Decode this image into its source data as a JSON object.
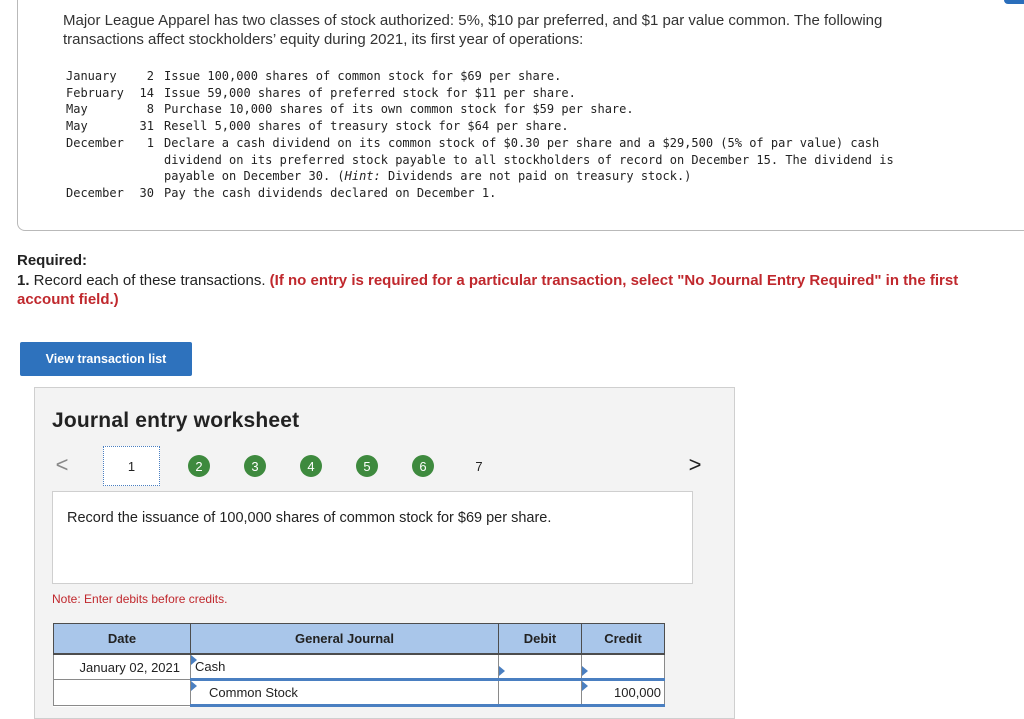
{
  "intro": "Major League Apparel has two classes of stock authorized: 5%, $10 par preferred, and $1 par value common. The following transactions affect stockholders’ equity during 2021, its first year of operations:",
  "transactions": [
    {
      "month": "January",
      "day": "2",
      "text": "Issue 100,000 shares of common stock for $69 per share."
    },
    {
      "month": "February",
      "day": "14",
      "text": "Issue 59,000 shares of preferred stock for $11 per share."
    },
    {
      "month": "May",
      "day": "8",
      "text": "Purchase 10,000 shares of its own common stock for $59 per share."
    },
    {
      "month": "May",
      "day": "31",
      "text": "Resell 5,000 shares of treasury stock for $64 per share."
    },
    {
      "month": "December",
      "day": "1",
      "text_before_hint": "Declare a cash dividend on its common stock of $0.30 per share and a $29,500 (5% of par value) cash dividend on its preferred stock payable to all stockholders of record on December 15. The dividend is payable on December 30. (",
      "hint_label": "Hint:",
      "text_after_hint": " Dividends are not paid on treasury stock.)"
    },
    {
      "month": "December",
      "day": "30",
      "text": "Pay the cash dividends declared on December 1."
    }
  ],
  "required": {
    "heading": "Required:",
    "number": "1.",
    "text": " Record each of these transactions. ",
    "emphasis": "(If no entry is required for a particular transaction, select \"No Journal Entry Required\" in the first account field.)"
  },
  "view_button": "View transaction list",
  "worksheet": {
    "title": "Journal entry worksheet",
    "steps": [
      "1",
      "2",
      "3",
      "4",
      "5",
      "6",
      "7"
    ],
    "prev_arrow": "<",
    "next_arrow": ">",
    "description": "Record the issuance of 100,000 shares of common stock for $69 per share.",
    "note": "Note: Enter debits before credits.",
    "columns": {
      "date": "Date",
      "journal": "General Journal",
      "debit": "Debit",
      "credit": "Credit"
    },
    "rows": [
      {
        "date": "January 02, 2021",
        "account": "Cash",
        "debit": "",
        "credit": ""
      },
      {
        "date": "",
        "account": "Common Stock",
        "debit": "",
        "credit": "100,000"
      }
    ]
  },
  "colors": {
    "accent": "#2e72bd",
    "step_done": "#3e8a3e",
    "warning_red": "#c0282d",
    "table_header": "#a9c6ea"
  }
}
